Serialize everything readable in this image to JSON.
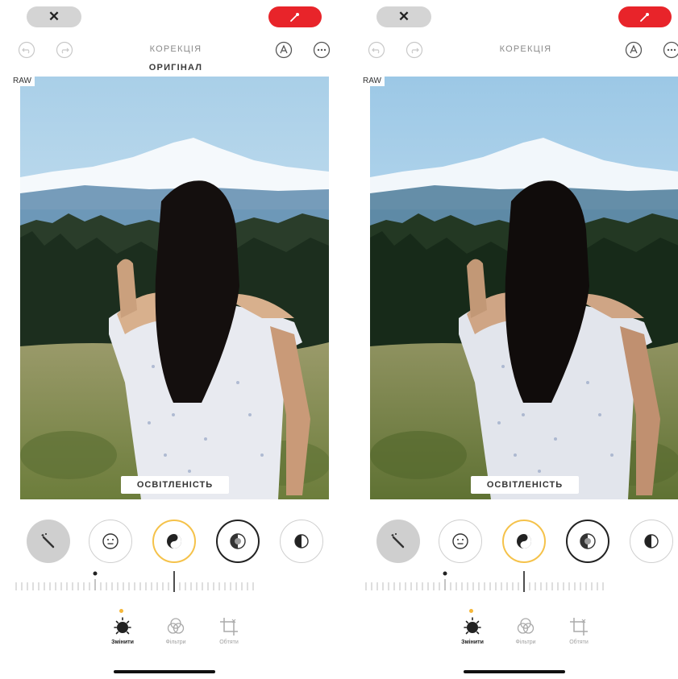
{
  "left": {
    "header": {
      "cancel_glyph": "✕",
      "done_icon": "magic-wand-icon",
      "title": "КОРЕКЦІЯ",
      "subtitle": "ОРИГІНАЛ"
    },
    "photo": {
      "raw_badge": "RAW",
      "param_label": "ОСВІТЛЕНІСТЬ"
    },
    "bottom_nav": {
      "items": [
        {
          "label": "Змінити",
          "icon": "adjust-icon",
          "active": true
        },
        {
          "label": "Фільтри",
          "icon": "filters-icon",
          "active": false
        },
        {
          "label": "Обтяти",
          "icon": "crop-icon",
          "active": false
        }
      ]
    }
  },
  "right": {
    "header": {
      "cancel_glyph": "✕",
      "done_icon": "magic-wand-icon",
      "title": "КОРЕКЦІЯ"
    },
    "photo": {
      "raw_badge": "RAW",
      "param_label": "ОСВІТЛЕНІСТЬ"
    },
    "bottom_nav": {
      "items": [
        {
          "label": "Змінити",
          "icon": "adjust-icon",
          "active": true
        },
        {
          "label": "Фільтри",
          "icon": "filters-icon",
          "active": false
        },
        {
          "label": "Обтяти",
          "icon": "crop-icon",
          "active": false
        }
      ]
    }
  },
  "tools": [
    "auto-enhance-icon",
    "face-icon",
    "exposure-icon",
    "brilliance-icon",
    "highlights-icon"
  ],
  "slider": {
    "value": -1
  },
  "colors": {
    "accent_red": "#e8242a",
    "accent_yellow": "#f5c24a",
    "pill_gray": "#d4d4d4"
  }
}
